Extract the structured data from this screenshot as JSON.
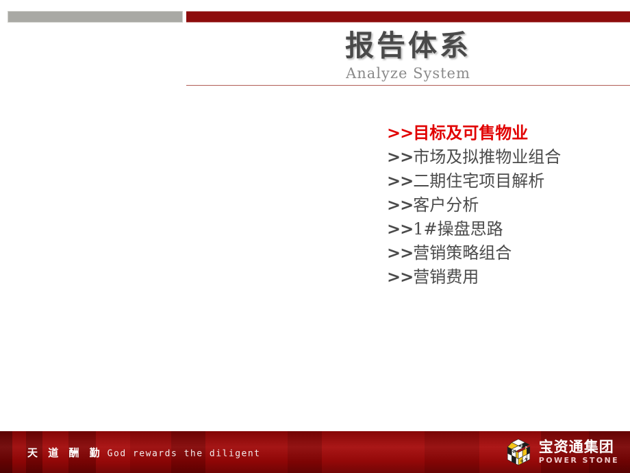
{
  "slide": {
    "background_color": "#ffffff",
    "accent_red": "#8d0c0c",
    "accent_gray": "#a9a9a4",
    "highlight_red": "#e10000"
  },
  "header": {
    "title": "报告体系",
    "subtitle": "Analyze System"
  },
  "agenda": {
    "items": [
      {
        "marker": ">>",
        "label": "目标及可售物业",
        "active": true
      },
      {
        "marker": ">>",
        "label": "市场及拟推物业组合",
        "active": false
      },
      {
        "marker": ">>",
        "label": "二期住宅项目解析",
        "active": false
      },
      {
        "marker": ">>",
        "label": "客户分析",
        "active": false
      },
      {
        "marker": ">>",
        "label": "1#操盘思路",
        "active": false
      },
      {
        "marker": ">>",
        "label": "营销策略组合",
        "active": false
      },
      {
        "marker": ">>",
        "label": "营销费用",
        "active": false
      }
    ]
  },
  "footer": {
    "motto_cn": "天 道 酬 勤",
    "motto_en": "God rewards the diligent",
    "logo": {
      "icon": "rubiks-cube-icon",
      "name_cn": "宝资通集团",
      "name_en": "POWER STONE"
    }
  }
}
